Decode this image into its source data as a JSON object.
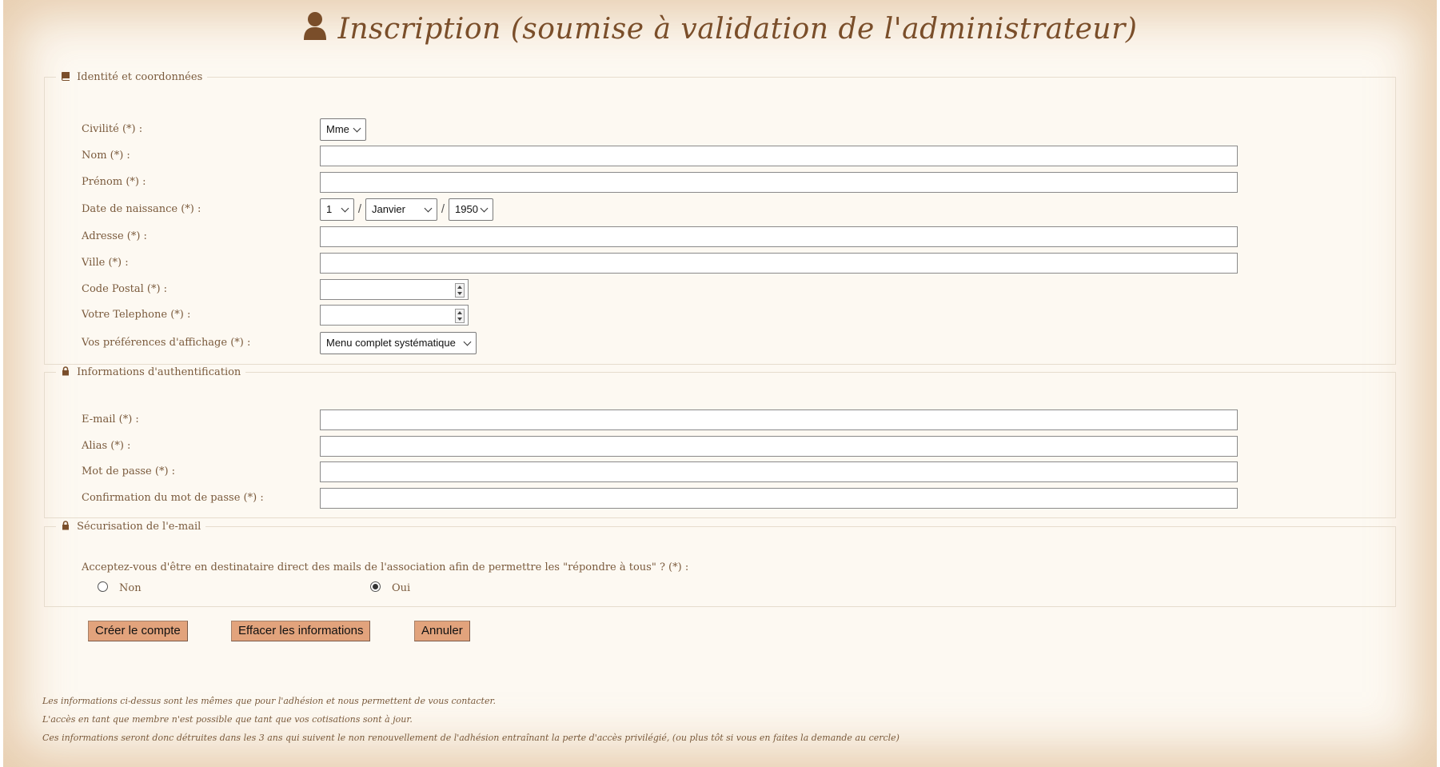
{
  "page_title": "Inscription (soumise à validation de l'administrateur)",
  "sections": {
    "identity": {
      "legend": "Identité et coordonnées",
      "civilite_label": "Civilité (*) :",
      "civilite_value": "Mme",
      "nom_label": "Nom (*) :",
      "prenom_label": "Prénom (*) :",
      "naissance_label": "Date de naissance (*) :",
      "naissance_day": "1",
      "naissance_month": "Janvier",
      "naissance_year": "1950",
      "date_separator": "/",
      "adresse_label": "Adresse (*) :",
      "ville_label": "Ville (*) :",
      "code_postal_label": "Code Postal (*) :",
      "telephone_label": "Votre Telephone (*) :",
      "preferences_label": "Vos préférences d'affichage (*) :",
      "preferences_value": "Menu complet systématique"
    },
    "auth": {
      "legend": "Informations d'authentification",
      "email_label": "E-mail (*) :",
      "alias_label": "Alias (*) :",
      "password_label": "Mot de passe (*) :",
      "password_confirm_label": "Confirmation du mot de passe (*) :"
    },
    "email_security": {
      "legend": "Sécurisation de l'e-mail",
      "question": "Acceptez-vous d'être en destinataire direct des mails de l'association afin de permettre les \"répondre à tous\" ? (*) :",
      "option_no": "Non",
      "option_yes": "Oui",
      "selected": "Oui"
    }
  },
  "buttons": {
    "create": "Créer le compte",
    "clear": "Effacer les informations",
    "cancel": "Annuler"
  },
  "notes": [
    "Les informations ci-dessus sont les mêmes que pour l'adhésion et nous permettent de vous contacter.",
    "L'accès en tant que membre n'est possible que tant que vos cotisations sont à jour.",
    "Ces informations seront donc détruites dans les 3 ans qui suivent le non renouvellement de l'adhésion entraînant la perte d'accès privilégié, (ou plus tôt si vous en faites la demande au cercle)"
  ],
  "icons": {
    "title": "user-icon",
    "identity": "book-icon",
    "auth": "lock-icon",
    "email_security": "lock-icon"
  },
  "colors": {
    "text_brown": "#7a5a3c",
    "title_brown": "#7a4e2a",
    "button_bg": "#e2a37c",
    "page_bg": "#fdf9f2"
  }
}
